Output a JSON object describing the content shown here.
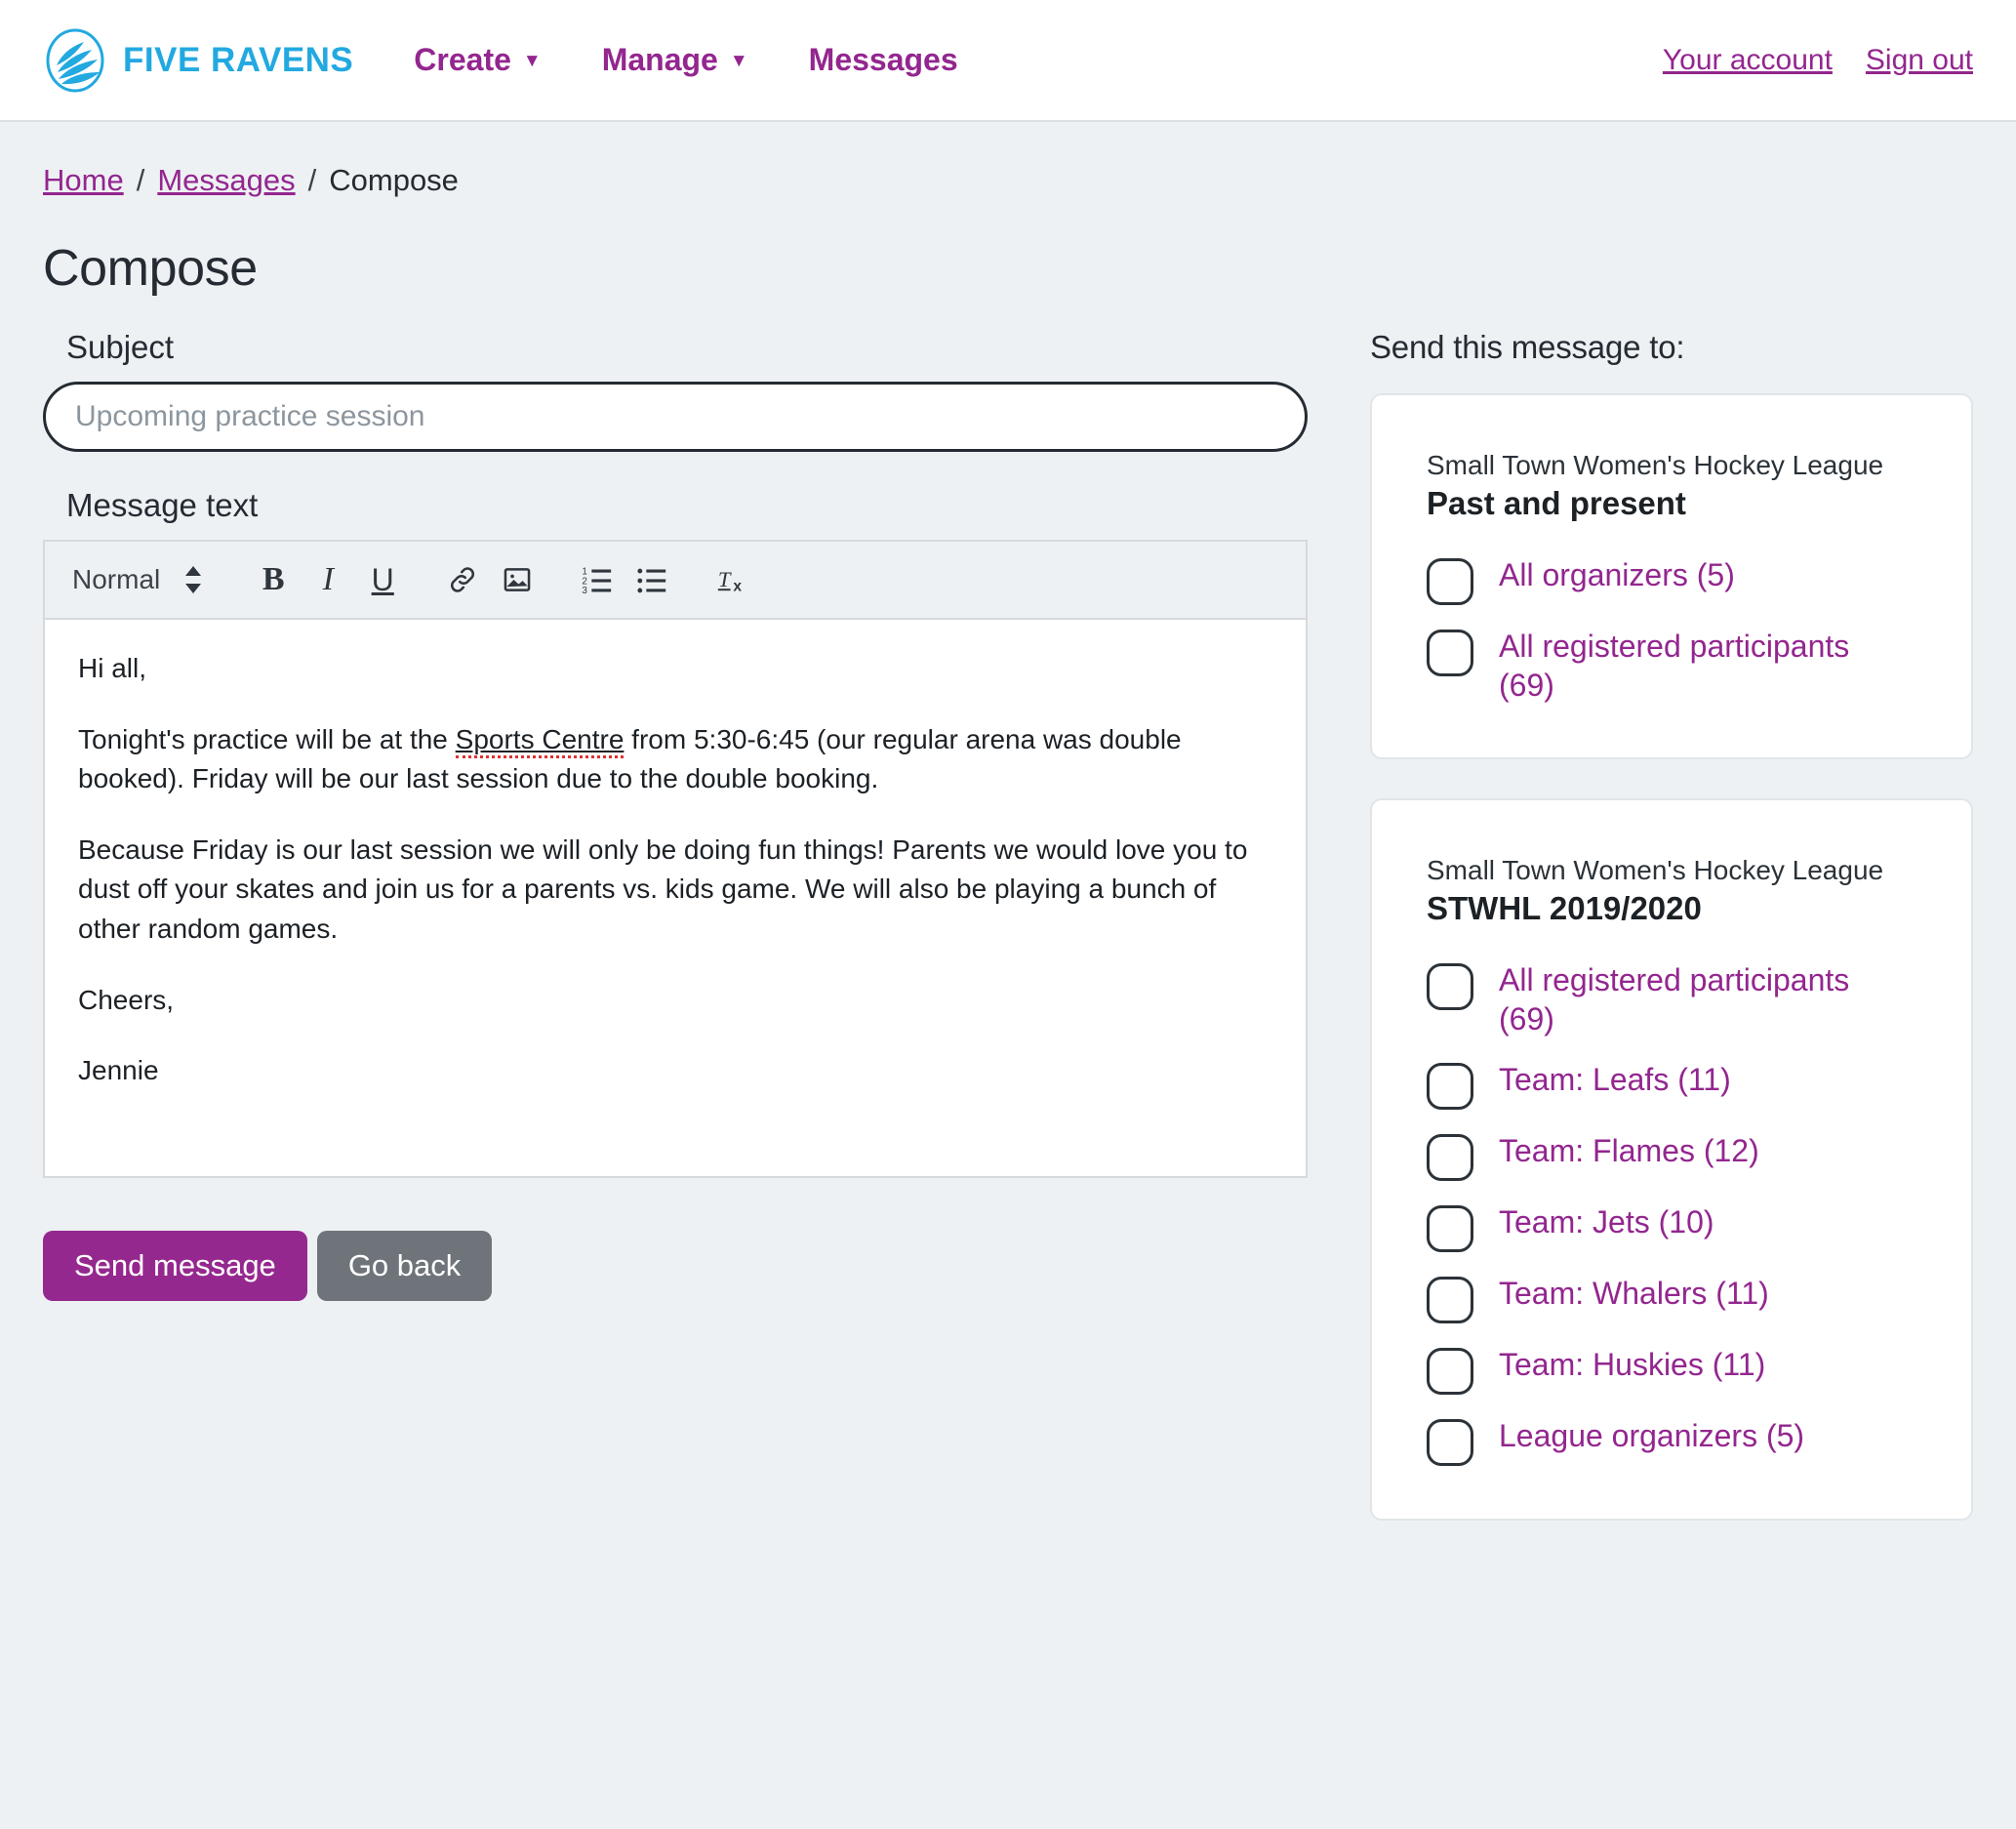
{
  "header": {
    "brand_name": "FIVE RAVENS",
    "brand_color": "#22a9e0",
    "accent_color": "#93268f",
    "nav": [
      {
        "label": "Create",
        "has_caret": true,
        "caret": "▼"
      },
      {
        "label": "Manage",
        "has_caret": true,
        "caret": "▼"
      },
      {
        "label": "Messages",
        "has_caret": false,
        "caret": ""
      }
    ],
    "account_link": "Your account",
    "signout_link": "Sign out"
  },
  "breadcrumb": {
    "home": "Home",
    "sep1": "/",
    "messages": "Messages",
    "sep2": "/",
    "current": "Compose"
  },
  "page_title": "Compose",
  "form": {
    "subject_label": "Subject",
    "subject_value": "",
    "subject_placeholder": "Upcoming practice session",
    "message_label": "Message text",
    "toolbar": {
      "format_select": "Normal",
      "stepper_icon": "updown-stepper-icon",
      "bold": "B",
      "italic": "I",
      "underline": "U",
      "link_icon": "link-icon",
      "image_icon": "image-icon",
      "ordered_list_icon": "ordered-list-icon",
      "bullet_list_icon": "bullet-list-icon",
      "clear_format_icon": "clear-formatting-icon"
    },
    "body_paragraphs": [
      {
        "text": "Hi all,"
      },
      {
        "pre": "Tonight's practice will be at the ",
        "misspelled": "Sports Centre",
        "post": " from 5:30-6:45 (our regular arena was double booked). Friday will be our last session due to the double booking."
      },
      {
        "text": "Because Friday is our last session we will only be doing fun things! Parents we would love you to dust off your skates and join us for a parents vs. kids game. We will also be playing a bunch of other random games."
      },
      {
        "text": "Cheers,"
      },
      {
        "text": "Jennie"
      }
    ],
    "send_button": "Send message",
    "back_button": "Go back"
  },
  "recipients": {
    "title": "Send this message to:",
    "cards": [
      {
        "org": "Small Town Women's Hockey League",
        "name": "Past and present",
        "options": [
          {
            "label": "All organizers (5)",
            "checked": false
          },
          {
            "label": "All registered participants (69)",
            "checked": false
          }
        ]
      },
      {
        "org": "Small Town Women's Hockey League",
        "name": "STWHL 2019/2020",
        "options": [
          {
            "label": "All registered participants (69)",
            "checked": false
          },
          {
            "label": "Team: Leafs (11)",
            "checked": false
          },
          {
            "label": "Team: Flames (12)",
            "checked": false
          },
          {
            "label": "Team: Jets (10)",
            "checked": false
          },
          {
            "label": "Team: Whalers (11)",
            "checked": false
          },
          {
            "label": "Team: Huskies (11)",
            "checked": false
          },
          {
            "label": "League organizers (5)",
            "checked": false
          }
        ]
      }
    ]
  }
}
